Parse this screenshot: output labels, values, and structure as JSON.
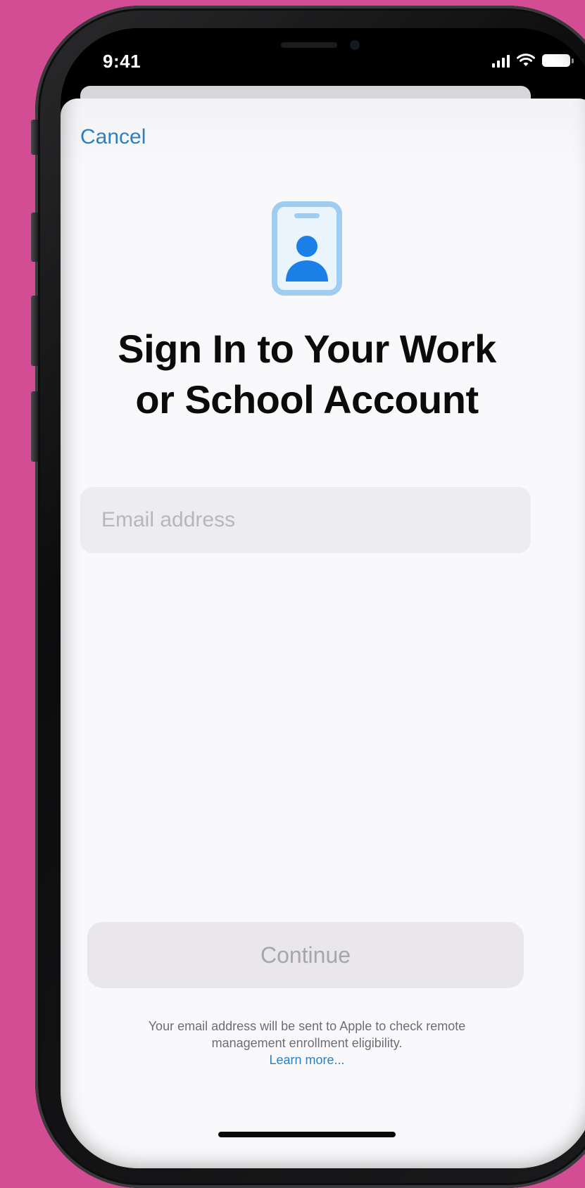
{
  "status_bar": {
    "time": "9:41"
  },
  "sheet": {
    "cancel_label": "Cancel",
    "title_line1": "Sign In to Your Work",
    "title_line2": "or School Account",
    "email_placeholder": "Email address",
    "email_value": "",
    "continue_label": "Continue",
    "disclaimer_line1": "Your email address will be sent to Apple to check remote",
    "disclaimer_line2": "management enrollment eligibility.",
    "learn_more_label": "Learn more..."
  },
  "colors": {
    "background": "#d24d93",
    "accent": "#2f7fbf",
    "icon_blue": "#1a7fe6",
    "icon_light": "#9fcdf2"
  },
  "icons": {
    "header_icon": "id-badge-person-icon"
  }
}
